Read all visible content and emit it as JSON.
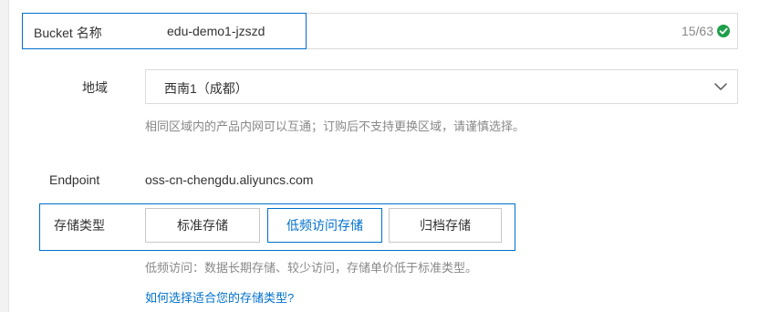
{
  "bucket": {
    "label": "Bucket 名称",
    "value": "edu-demo1-jzszd",
    "char_count": "15/63",
    "valid_icon": "check-circle-icon",
    "valid_color": "#1e9e4b"
  },
  "region": {
    "label": "地域",
    "selected": "西南1（成都）",
    "dropdown_icon": "chevron-down-icon",
    "hint": "相同区域内的产品内网可以互通；订购后不支持更换区域，请谨慎选择。"
  },
  "endpoint": {
    "label": "Endpoint",
    "value": "oss-cn-chengdu.aliyuncs.com"
  },
  "storage": {
    "label": "存储类型",
    "options": [
      {
        "label": "标准存储",
        "selected": false
      },
      {
        "label": "低频访问存储",
        "selected": true
      },
      {
        "label": "归档存储",
        "selected": false
      }
    ],
    "hint": "低频访问：数据长期存储、较少访问，存储单价低于标准类型。",
    "help_link": "如何选择适合您的存储类型?",
    "accent_color": "#0070cc"
  }
}
